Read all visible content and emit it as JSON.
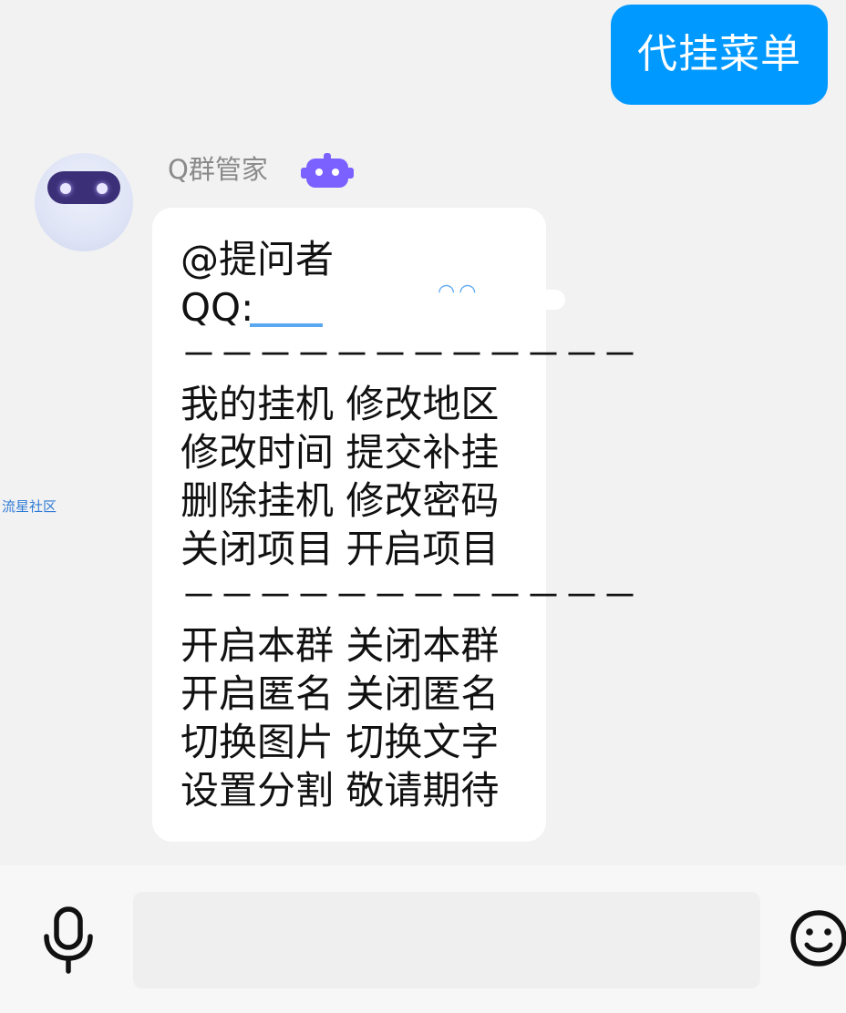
{
  "chat": {
    "sent_message": "代挂菜单",
    "sender_name": "Q群管家",
    "received_lines": [
      "@提问者",
      "QQ:",
      "－－－－－－－－－－－－",
      "我的挂机 修改地区",
      "修改时间 提交补挂",
      "删除挂机 修改密码",
      "关闭项目 开启项目",
      "－－－－－－－－－－－－",
      "开启本群 关闭本群",
      "开启匿名 关闭匿名",
      "切换图片 切换文字",
      "设置分割 敬请期待"
    ],
    "watermark": "流星社区"
  },
  "input_bar": {
    "placeholder": "",
    "value": ""
  },
  "icons": {
    "voice": "microphone-icon",
    "emoji": "smiley-icon",
    "bot_badge": "robot-badge-icon",
    "avatar": "robot-avatar"
  },
  "colors": {
    "sent_bubble": "#0099ff",
    "background": "#f2f2f2",
    "received_bubble": "#ffffff",
    "bot_badge": "#7b61ff"
  }
}
